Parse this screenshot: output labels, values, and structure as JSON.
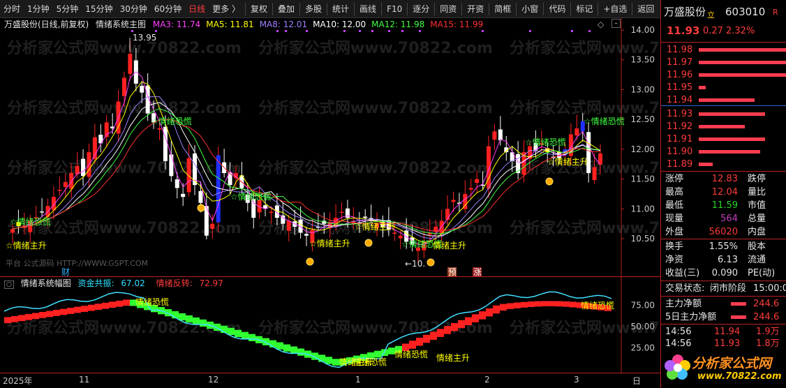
{
  "toolbar": {
    "periods": [
      "分时",
      "1分钟",
      "5分钟",
      "15分钟",
      "30分钟",
      "60分钟",
      "日线",
      "更多 〉"
    ],
    "active_period": "日线",
    "actions": [
      "复权",
      "叠加",
      "多股",
      "统计",
      "画线",
      "F10",
      "逐分",
      "同资",
      "开资",
      "简框",
      "小窗",
      "代码",
      "标记",
      "+自选",
      "返回"
    ]
  },
  "main_legend": {
    "title": "万盛股份(日线,前复权)",
    "indicator_name": "情绪系统主图",
    "ma": [
      {
        "label": "MA3:",
        "value": "11.74",
        "color": "#ff40ff"
      },
      {
        "label": "MA5:",
        "value": "11.81",
        "color": "#ffff00"
      },
      {
        "label": "MA8:",
        "value": "12.01",
        "color": "#a080ff"
      },
      {
        "label": "MA10:",
        "value": "12.00",
        "color": "#ffffff"
      },
      {
        "label": "MA12:",
        "value": "11.98",
        "color": "#40ff40"
      },
      {
        "label": "MA15:",
        "value": "11.99",
        "color": "#ff3030"
      }
    ]
  },
  "price_axis": [
    "14.00",
    "13.50",
    "13.00",
    "12.50",
    "12.00",
    "11.50",
    "11.00",
    "10.50"
  ],
  "annotations": {
    "high": "13.95",
    "low": "←10.",
    "panic": "情绪恐慌",
    "main_up": "情绪主升",
    "star_main_up": "☆情绪主升",
    "star_panic": "☆情绪恐慌",
    "fin": "财",
    "pre": "预",
    "up": "涨",
    "source": "平台 公式源码 HTTP://WWW.GSPT.COM"
  },
  "indicator_legend": {
    "name": "情绪系统幅图",
    "fund_label": "资金共振:",
    "fund_value": "67.02",
    "rev_label": "情绪反转:",
    "rev_value": "72.97"
  },
  "indicator_axis": [
    "75.00",
    "50.00",
    "25.00"
  ],
  "x_axis": [
    "2025年",
    "11",
    "12",
    "1",
    "2",
    "3",
    "日"
  ],
  "quote": {
    "name": "万盛股份",
    "flag": "立",
    "code": "603010",
    "r_mark": "R",
    "price": "11.93",
    "change": "0.27",
    "pct": "2.32%",
    "asks": [
      {
        "p": "11.98",
        "w": 150
      },
      {
        "p": "11.97",
        "w": 145
      },
      {
        "p": "11.96",
        "w": 152
      },
      {
        "p": "11.95",
        "w": 10
      },
      {
        "p": "11.94",
        "w": 80
      }
    ],
    "bids": [
      {
        "p": "11.93",
        "w": 95
      },
      {
        "p": "11.92",
        "w": 66
      },
      {
        "p": "11.91",
        "w": 95
      },
      {
        "p": "11.90",
        "w": 88
      },
      {
        "p": "11.89",
        "w": 20
      }
    ],
    "stats": [
      {
        "l": "涨停",
        "v": "12.83",
        "vc": "red",
        "r": "跌停"
      },
      {
        "l": "最高",
        "v": "12.04",
        "vc": "red",
        "r": "量比"
      },
      {
        "l": "最低",
        "v": "11.59",
        "vc": "green",
        "r": "市值"
      },
      {
        "l": "现量",
        "v": "564",
        "vc": "purple",
        "r": "总量"
      },
      {
        "l": "外盘",
        "v": "56020",
        "vc": "red",
        "r": "内盘"
      }
    ],
    "stats2": [
      {
        "l": "换手",
        "v": "1.55%",
        "r": "股本"
      },
      {
        "l": "净资",
        "v": "6.13",
        "r": "流通"
      },
      {
        "l": "收益(三)",
        "v": "0.090",
        "r": "PE(动)"
      }
    ],
    "trade_status_label": "交易状态:",
    "trade_status": "闭市阶段",
    "trade_time": "15:00:0",
    "flow": [
      {
        "l": "主力净额",
        "v": "244.6"
      },
      {
        "l": "5日主力净额",
        "v": "244.6"
      }
    ],
    "ticks": [
      {
        "t": "14:56",
        "p": "11.94",
        "v": "1.9万"
      },
      {
        "t": "14:56",
        "p": "11.93",
        "v": "1.8万"
      }
    ]
  },
  "logo": {
    "text": "分析家公式网",
    "url": "www.70822.com"
  },
  "watermark": "分析家公式网www.70822.com"
}
